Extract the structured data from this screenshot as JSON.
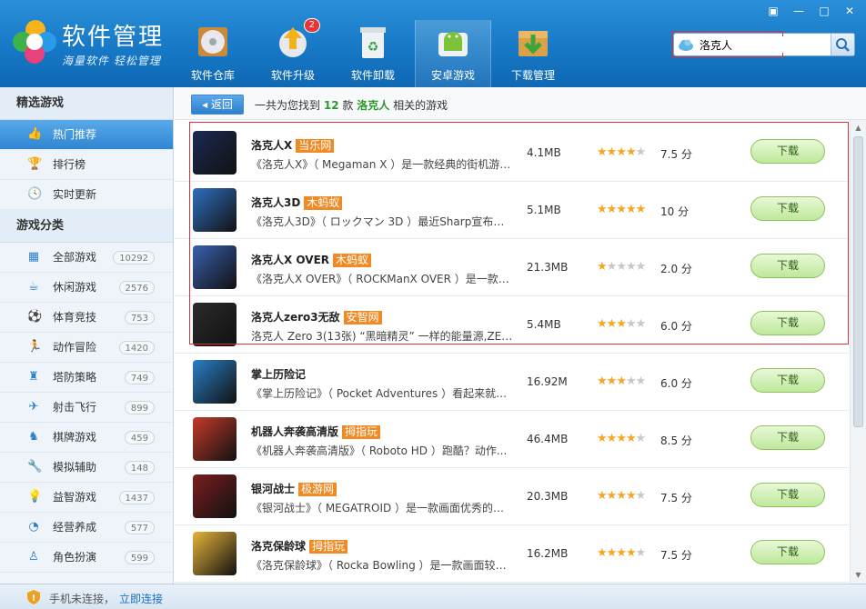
{
  "app": {
    "title": "软件管理",
    "slogan": "海量软件 轻松管理"
  },
  "window_controls": [
    "▣",
    "—",
    "□",
    "✕"
  ],
  "nav": [
    {
      "label": "软件仓库",
      "icon": "disc-icon"
    },
    {
      "label": "软件升级",
      "icon": "upgrade-icon",
      "badge": "2"
    },
    {
      "label": "软件卸载",
      "icon": "recycle-bin-icon"
    },
    {
      "label": "安卓游戏",
      "icon": "android-game-icon",
      "active": true
    },
    {
      "label": "下载管理",
      "icon": "download-box-icon"
    }
  ],
  "search": {
    "value": "洛克人",
    "placeholder": ""
  },
  "sidebar": {
    "section1_title": "精选游戏",
    "section1_items": [
      {
        "label": "热门推荐",
        "icon": "👍",
        "active": true
      },
      {
        "label": "排行榜",
        "icon": "🏆"
      },
      {
        "label": "实时更新",
        "icon": "🕓"
      }
    ],
    "section2_title": "游戏分类",
    "section2_items": [
      {
        "label": "全部游戏",
        "icon": "▦",
        "count": "10292"
      },
      {
        "label": "休闲游戏",
        "icon": "☕",
        "count": "2576"
      },
      {
        "label": "体育竞技",
        "icon": "⚽",
        "count": "753"
      },
      {
        "label": "动作冒险",
        "icon": "🏃",
        "count": "1420"
      },
      {
        "label": "塔防策略",
        "icon": "♜",
        "count": "749"
      },
      {
        "label": "射击飞行",
        "icon": "✈",
        "count": "899"
      },
      {
        "label": "棋牌游戏",
        "icon": "♞",
        "count": "459"
      },
      {
        "label": "模拟辅助",
        "icon": "🔧",
        "count": "148"
      },
      {
        "label": "益智游戏",
        "icon": "💡",
        "count": "1437"
      },
      {
        "label": "经营养成",
        "icon": "◔",
        "count": "577"
      },
      {
        "label": "角色扮演",
        "icon": "♙",
        "count": "599"
      }
    ]
  },
  "topbar": {
    "back_label": "返回",
    "result_prefix": "一共为您找到",
    "result_count": "12",
    "result_mid": "款",
    "result_keyword": "洛克人",
    "result_suffix": "相关的游戏"
  },
  "games": [
    {
      "name": "洛克人X",
      "source": "当乐网",
      "desc": "《洛克人X》（ Megaman X ）是一款经典的街机游戏...",
      "size": "4.1MB",
      "rating": 4,
      "score": "7.5 分",
      "download": "下载",
      "thumb": "#1c2a54"
    },
    {
      "name": "洛克人3D",
      "source": "木蚂蚁",
      "desc": "《洛克人3D》（ ロックマン 3D ）最近Sharp宣布即将...",
      "size": "5.1MB",
      "rating": 5,
      "score": "10 分",
      "download": "下载",
      "thumb": "#2f6fc0"
    },
    {
      "name": "洛克人X OVER",
      "source": "木蚂蚁",
      "desc": "《洛克人X OVER》（ ROCKManX OVER ）是一款由...",
      "size": "21.3MB",
      "rating": 1,
      "score": "2.0 分",
      "download": "下载",
      "thumb": "#3a5fb0"
    },
    {
      "name": "洛克人zero3无敌",
      "source": "安智网",
      "desc": "洛克人 Zero 3(13张) “黑暗精灵” 一样的能量源,ZERO...",
      "size": "5.4MB",
      "rating": 3,
      "score": "6.0 分",
      "download": "下载",
      "thumb": "#2b2b2b"
    },
    {
      "name": "掌上历险记",
      "source": "",
      "desc": "《掌上历险记》（ Pocket Adventures ）看起来就像一...",
      "size": "16.92M",
      "rating": 3,
      "score": "6.0 分",
      "download": "下载",
      "thumb": "#2a7fc8"
    },
    {
      "name": "机器人奔袭高清版",
      "source": "拇指玩",
      "desc": "《机器人奔袭高清版》（ Roboto HD ）跑酷？动作...",
      "size": "46.4MB",
      "rating": 4,
      "score": "8.5 分",
      "download": "下载",
      "thumb": "#c43a2a"
    },
    {
      "name": "银河战士",
      "source": "极游网",
      "desc": "《银河战士》（ MEGATROID ）是一款画面优秀的横版...",
      "size": "20.3MB",
      "rating": 4,
      "score": "7.5 分",
      "download": "下载",
      "thumb": "#7a1e1e"
    },
    {
      "name": "洛克保龄球",
      "source": "拇指玩",
      "desc": "《洛克保龄球》（ Rocka Bowling ）是一款画面较为...",
      "size": "16.2MB",
      "rating": 4,
      "score": "7.5 分",
      "download": "下载",
      "thumb": "#e8b43a"
    }
  ],
  "status": {
    "text": "手机未连接，",
    "link": "立即连接"
  }
}
